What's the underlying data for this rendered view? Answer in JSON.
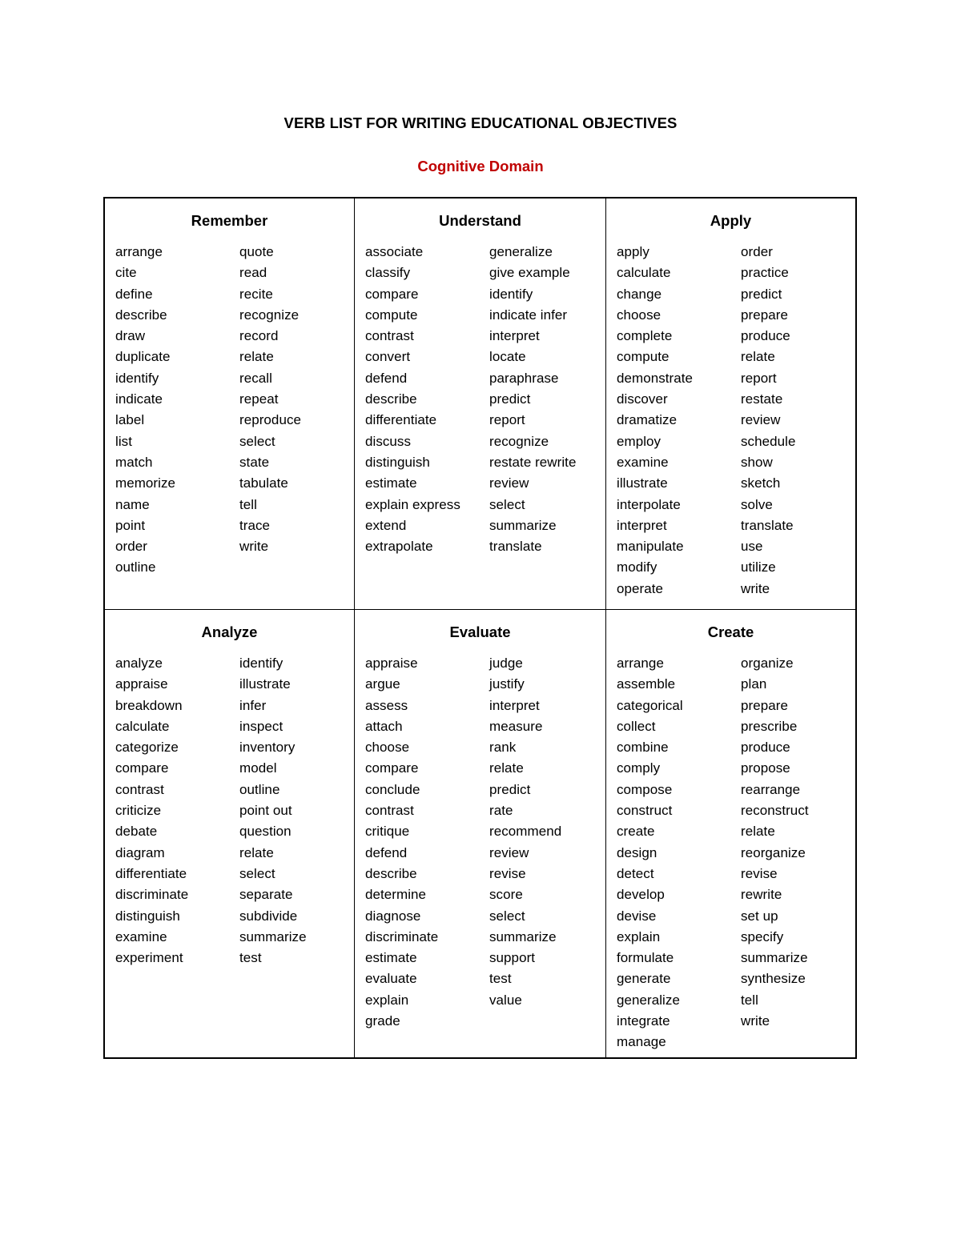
{
  "document": {
    "title": "VERB LIST FOR WRITING EDUCATIONAL OBJECTIVES",
    "subtitle": "Cognitive Domain",
    "subtitle_color": "#C00000"
  },
  "table": {
    "rows": [
      {
        "cells": [
          {
            "heading": "Remember",
            "col_a": [
              "arrange",
              "cite",
              "define",
              "describe",
              "draw",
              "duplicate",
              "identify",
              "indicate",
              "label",
              "list",
              "match",
              "memorize",
              "name",
              "point",
              "order",
              "outline"
            ],
            "col_b": [
              "quote",
              "read",
              "recite",
              "recognize",
              "record",
              "relate",
              "recall",
              "repeat",
              "reproduce",
              "select",
              "state",
              "tabulate",
              "tell",
              "trace",
              "write"
            ]
          },
          {
            "heading": "Understand",
            "col_a": [
              "associate",
              "classify",
              "compare",
              "compute",
              "contrast",
              "convert",
              "defend",
              "describe",
              "differentiate",
              "discuss",
              "distinguish",
              "estimate",
              "explain express",
              "extend",
              "extrapolate"
            ],
            "col_b": [
              "generalize",
              "give example",
              "identify",
              "indicate infer",
              "interpret",
              "locate",
              "paraphrase",
              "predict",
              "report",
              "recognize",
              "restate rewrite",
              "review",
              "select",
              "summarize",
              "translate"
            ]
          },
          {
            "heading": "Apply",
            "col_a": [
              "apply",
              "calculate",
              "change",
              "choose",
              "complete",
              "compute",
              "demonstrate",
              "discover",
              "dramatize",
              "employ",
              "examine",
              "illustrate",
              "interpolate",
              "interpret",
              "manipulate",
              "modify",
              "operate"
            ],
            "col_b": [
              "order",
              "practice",
              "predict",
              "prepare",
              "produce",
              "relate",
              "report",
              "restate",
              "review",
              "schedule",
              "show",
              "sketch",
              "solve",
              "translate",
              "use",
              "utilize",
              "write"
            ]
          }
        ]
      },
      {
        "cells": [
          {
            "heading": "Analyze",
            "col_a": [
              "analyze",
              "appraise",
              "breakdown",
              "calculate",
              "categorize",
              "compare",
              "contrast",
              "criticize",
              "debate",
              "diagram",
              "differentiate",
              "discriminate",
              "distinguish",
              "examine",
              "experiment"
            ],
            "col_b": [
              "identify",
              "illustrate",
              "infer",
              "inspect",
              "inventory",
              "model",
              "outline",
              "point out",
              "question",
              "relate",
              "select",
              "separate",
              "subdivide",
              "summarize",
              "test"
            ]
          },
          {
            "heading": "Evaluate",
            "col_a": [
              "appraise",
              "argue",
              "assess",
              "attach",
              "choose",
              "compare",
              "conclude",
              "contrast",
              "critique",
              "defend",
              "describe",
              "determine",
              "diagnose",
              "discriminate",
              "estimate",
              "evaluate",
              "explain",
              "grade"
            ],
            "col_b": [
              "judge",
              "justify",
              "interpret",
              "measure",
              "rank",
              "relate",
              "predict",
              "rate",
              "recommend",
              "review",
              "revise",
              "score",
              "select",
              "summarize",
              "support",
              "test",
              "value"
            ]
          },
          {
            "heading": "Create",
            "col_a": [
              "arrange",
              "assemble",
              "categorical",
              "collect",
              "combine",
              "comply",
              "compose",
              "construct",
              "create",
              "design",
              "detect",
              "develop",
              "devise",
              "explain",
              "formulate",
              "generate",
              "generalize",
              "integrate",
              "manage"
            ],
            "col_b": [
              "organize",
              "plan",
              "prepare",
              "prescribe",
              "produce",
              "propose",
              "rearrange",
              "reconstruct",
              "relate",
              "reorganize",
              "revise",
              "rewrite",
              "set up",
              "specify",
              "summarize",
              "synthesize",
              "tell",
              "write"
            ]
          }
        ]
      }
    ]
  }
}
